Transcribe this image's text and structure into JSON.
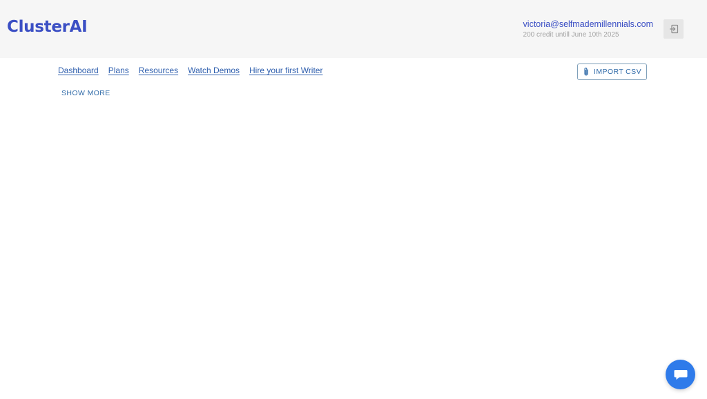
{
  "header": {
    "logo": "ClusterAI",
    "user_email": "victoria@selfmademillennials.com",
    "credit_text": "200 credit untill June 10th 2025",
    "logout_icon": "logout-icon"
  },
  "nav": {
    "links": [
      "Dashboard",
      "Plans",
      "Resources",
      "Watch Demos",
      "Hire your first Writer"
    ],
    "show_more": "SHOW MORE"
  },
  "actions": {
    "import_csv": "IMPORT CSV",
    "import_icon": "paperclip-icon"
  },
  "chat": {
    "icon": "chat-bubble-icon"
  },
  "colors": {
    "brand": "#3b4fc4",
    "link": "#2f5fae",
    "chat": "#2f7bea",
    "header_bg": "#f6f6f6"
  }
}
